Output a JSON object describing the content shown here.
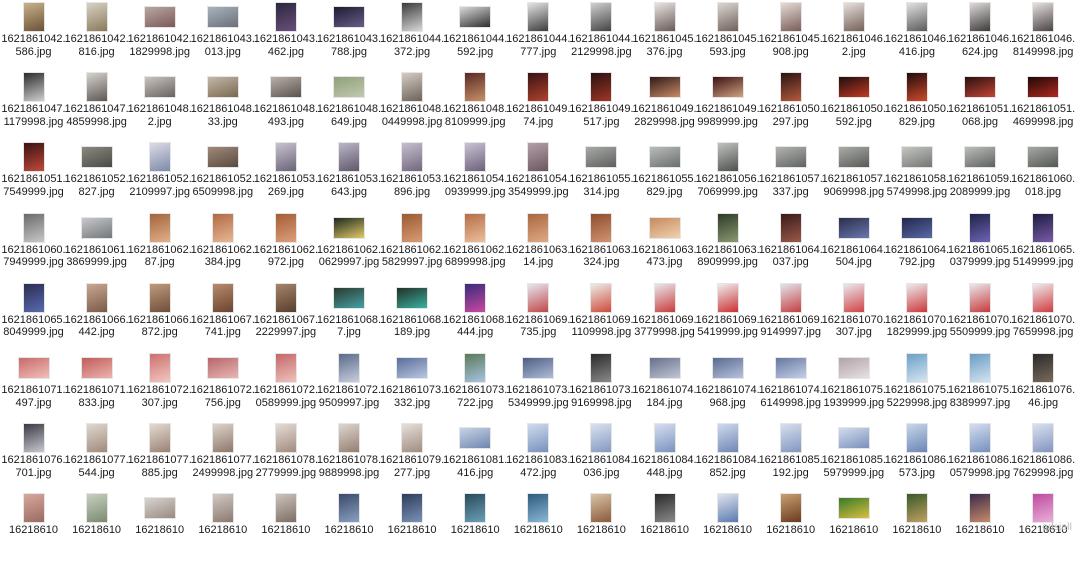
{
  "files": [
    {
      "name": "1621861042.586.jpg",
      "thumb": "p",
      "colors": [
        "#c9b28a",
        "#6b5236"
      ]
    },
    {
      "name": "1621861042.816.jpg",
      "thumb": "p",
      "colors": [
        "#d8d2c4",
        "#8a7a5a"
      ]
    },
    {
      "name": "1621861042.1829998.jpg",
      "thumb": "l",
      "colors": [
        "#b9a7a3",
        "#7b5a58"
      ]
    },
    {
      "name": "1621861043.013.jpg",
      "thumb": "l",
      "colors": [
        "#a7b3bd",
        "#6b6f78"
      ]
    },
    {
      "name": "1621861043.462.jpg",
      "thumb": "p",
      "colors": [
        "#2b2740",
        "#6a4f7a"
      ]
    },
    {
      "name": "1621861043.788.jpg",
      "thumb": "l",
      "colors": [
        "#1f1b33",
        "#6a5d88"
      ]
    },
    {
      "name": "1621861044.372.jpg",
      "thumb": "p",
      "colors": [
        "#3a3a3a",
        "#d8d8d8"
      ]
    },
    {
      "name": "1621861044.592.jpg",
      "thumb": "l",
      "colors": [
        "#d9d9d9",
        "#2e2e2e"
      ]
    },
    {
      "name": "1621861044.777.jpg",
      "thumb": "p",
      "colors": [
        "#e4e4e4",
        "#3c3c3c"
      ]
    },
    {
      "name": "1621861044.2129998.jpg",
      "thumb": "p",
      "colors": [
        "#d0d0d0",
        "#444444"
      ]
    },
    {
      "name": "1621861045.376.jpg",
      "thumb": "p",
      "colors": [
        "#e8e4e2",
        "#6a5a58"
      ]
    },
    {
      "name": "1621861045.593.jpg",
      "thumb": "p",
      "colors": [
        "#ddd6d0",
        "#6e625c"
      ]
    },
    {
      "name": "1621861045.908.jpg",
      "thumb": "p",
      "colors": [
        "#e6dcd6",
        "#7a5c58"
      ]
    },
    {
      "name": "1621861046.2.jpg",
      "thumb": "p",
      "colors": [
        "#e8e0dc",
        "#74605a"
      ]
    },
    {
      "name": "1621861046.416.jpg",
      "thumb": "p",
      "colors": [
        "#e2e2e2",
        "#5a5a5a"
      ]
    },
    {
      "name": "1621861046.624.jpg",
      "thumb": "p",
      "colors": [
        "#dedad8",
        "#3e3a3a"
      ]
    },
    {
      "name": "1621861046.8149998.jpg",
      "thumb": "p",
      "colors": [
        "#e6e2e0",
        "#4a4444"
      ]
    },
    {
      "name": "1621861047.1179998.jpg",
      "thumb": "p",
      "colors": [
        "#2c2c2c",
        "#cfcfcf"
      ]
    },
    {
      "name": "1621861047.4859998.jpg",
      "thumb": "p",
      "colors": [
        "#d6d2ce",
        "#5e5854"
      ]
    },
    {
      "name": "1621861048.2.jpg",
      "thumb": "l",
      "colors": [
        "#c8c4c0",
        "#6a625e"
      ]
    },
    {
      "name": "1621861048.33.jpg",
      "thumb": "l",
      "colors": [
        "#c4b8a8",
        "#7a6850"
      ]
    },
    {
      "name": "1621861048.493.jpg",
      "thumb": "l",
      "colors": [
        "#b8b0a8",
        "#5a524c"
      ]
    },
    {
      "name": "1621861048.649.jpg",
      "thumb": "l",
      "colors": [
        "#8fa07a",
        "#c2c8b0"
      ]
    },
    {
      "name": "1621861048.0449998.jpg",
      "thumb": "p",
      "colors": [
        "#d4ccc4",
        "#6e625a"
      ]
    },
    {
      "name": "1621861048.8109999.jpg",
      "thumb": "p",
      "colors": [
        "#5a2a22",
        "#c8906a"
      ]
    },
    {
      "name": "1621861049.74.jpg",
      "thumb": "p",
      "colors": [
        "#3a1212",
        "#b0442c"
      ]
    },
    {
      "name": "1621861049.517.jpg",
      "thumb": "p",
      "colors": [
        "#2a1010",
        "#a03626"
      ]
    },
    {
      "name": "1621861049.2829998.jpg",
      "thumb": "l",
      "colors": [
        "#2e1a18",
        "#c88a66"
      ]
    },
    {
      "name": "1621861049.9989999.jpg",
      "thumb": "l",
      "colors": [
        "#3a1212",
        "#d0a080"
      ]
    },
    {
      "name": "1621861050.297.jpg",
      "thumb": "p",
      "colors": [
        "#2a1414",
        "#b45a3a"
      ]
    },
    {
      "name": "1621861050.592.jpg",
      "thumb": "l",
      "colors": [
        "#1e0e0e",
        "#c23a22"
      ]
    },
    {
      "name": "1621861050.829.jpg",
      "thumb": "p",
      "colors": [
        "#200c0c",
        "#d04a2c"
      ]
    },
    {
      "name": "1621861051.068.jpg",
      "thumb": "l",
      "colors": [
        "#2a1010",
        "#c44434"
      ]
    },
    {
      "name": "1621861051.4699998.jpg",
      "thumb": "l",
      "colors": [
        "#200808",
        "#b02a1e"
      ]
    },
    {
      "name": "1621861051.7549999.jpg",
      "thumb": "p",
      "colors": [
        "#3a1212",
        "#c04a3a"
      ]
    },
    {
      "name": "1621861052.827.jpg",
      "thumb": "l",
      "colors": [
        "#8a8a80",
        "#4a4a44"
      ]
    },
    {
      "name": "1621861052.2109997.jpg",
      "thumb": "p",
      "colors": [
        "#dcdce6",
        "#7e8aa8"
      ]
    },
    {
      "name": "1621861052.6509998.jpg",
      "thumb": "l",
      "colors": [
        "#a08a7a",
        "#5a4a3e"
      ]
    },
    {
      "name": "1621861053.269.jpg",
      "thumb": "p",
      "colors": [
        "#c8c2d0",
        "#6a6478"
      ]
    },
    {
      "name": "1621861053.643.jpg",
      "thumb": "p",
      "colors": [
        "#bcb6c8",
        "#5e586a"
      ]
    },
    {
      "name": "1621861053.896.jpg",
      "thumb": "p",
      "colors": [
        "#c6bfd0",
        "#72687e"
      ]
    },
    {
      "name": "1621861054.0939999.jpg",
      "thumb": "p",
      "colors": [
        "#cac2d4",
        "#6c627c"
      ]
    },
    {
      "name": "1621861054.3549999.jpg",
      "thumb": "p",
      "colors": [
        "#b4a0a8",
        "#6a5660"
      ]
    },
    {
      "name": "1621861055.314.jpg",
      "thumb": "l",
      "colors": [
        "#a8aaa8",
        "#5e605c"
      ]
    },
    {
      "name": "1621861055.829.jpg",
      "thumb": "l",
      "colors": [
        "#b8bcbc",
        "#6a706e"
      ]
    },
    {
      "name": "1621861056.7069999.jpg",
      "thumb": "p",
      "colors": [
        "#c0c2c0",
        "#4e524e"
      ]
    },
    {
      "name": "1621861057.337.jpg",
      "thumb": "l",
      "colors": [
        "#b2b4b0",
        "#606460"
      ]
    },
    {
      "name": "1621861057.9069998.jpg",
      "thumb": "l",
      "colors": [
        "#aaaca8",
        "#585a56"
      ]
    },
    {
      "name": "1621861058.5749998.jpg",
      "thumb": "l",
      "colors": [
        "#c4c6c2",
        "#747672"
      ]
    },
    {
      "name": "1621861059.2089999.jpg",
      "thumb": "l",
      "colors": [
        "#bcbebc",
        "#5e625e"
      ]
    },
    {
      "name": "1621861060.018.jpg",
      "thumb": "l",
      "colors": [
        "#a6a8a4",
        "#545852"
      ]
    },
    {
      "name": "1621861060.7949999.jpg",
      "thumb": "p",
      "colors": [
        "#6a6a6a",
        "#c8c8c8"
      ]
    },
    {
      "name": "1621861061.3869999.jpg",
      "thumb": "l",
      "colors": [
        "#c8cacc",
        "#72767a"
      ]
    },
    {
      "name": "1621861062.87.jpg",
      "thumb": "p",
      "colors": [
        "#a2643e",
        "#e2b08a"
      ]
    },
    {
      "name": "1621861062.384.jpg",
      "thumb": "p",
      "colors": [
        "#b06a42",
        "#e8b894"
      ]
    },
    {
      "name": "1621861062.972.jpg",
      "thumb": "p",
      "colors": [
        "#a45c36",
        "#dca07a"
      ]
    },
    {
      "name": "1621861062.0629997.jpg",
      "thumb": "l",
      "colors": [
        "#1a2a1e",
        "#e2c86a"
      ]
    },
    {
      "name": "1621861062.5829997.jpg",
      "thumb": "p",
      "colors": [
        "#9a5a34",
        "#d89c72"
      ]
    },
    {
      "name": "1621861062.6899998.jpg",
      "thumb": "p",
      "colors": [
        "#b46e46",
        "#ecc09c"
      ]
    },
    {
      "name": "1621861063.14.jpg",
      "thumb": "p",
      "colors": [
        "#a86840",
        "#e0aa84"
      ]
    },
    {
      "name": "1621861063.324.jpg",
      "thumb": "p",
      "colors": [
        "#8e4e2e",
        "#d09470"
      ]
    },
    {
      "name": "1621861063.473.jpg",
      "thumb": "l",
      "colors": [
        "#c48a5e",
        "#f0d2b0"
      ]
    },
    {
      "name": "1621861063.8909999.jpg",
      "thumb": "p",
      "colors": [
        "#2e3a2a",
        "#8a9a6e"
      ]
    },
    {
      "name": "1621861064.037.jpg",
      "thumb": "p",
      "colors": [
        "#3a1a1a",
        "#9a5a4a"
      ]
    },
    {
      "name": "1621861064.504.jpg",
      "thumb": "l",
      "colors": [
        "#2a2e4a",
        "#6a78b0"
      ]
    },
    {
      "name": "1621861064.792.jpg",
      "thumb": "l",
      "colors": [
        "#22284a",
        "#5a6aa8"
      ]
    },
    {
      "name": "1621861065.0379999.jpg",
      "thumb": "p",
      "colors": [
        "#1e2248",
        "#6e64b4"
      ]
    },
    {
      "name": "1621861065.5149999.jpg",
      "thumb": "p",
      "colors": [
        "#1c1e3e",
        "#7a5aa8"
      ]
    },
    {
      "name": "1621861065.8049999.jpg",
      "thumb": "p",
      "colors": [
        "#2a2e52",
        "#5a6ab0"
      ]
    },
    {
      "name": "1621861066.442.jpg",
      "thumb": "p",
      "colors": [
        "#c8a890",
        "#7a5a48"
      ]
    },
    {
      "name": "1621861066.872.jpg",
      "thumb": "p",
      "colors": [
        "#c09a7c",
        "#6e4e3a"
      ]
    },
    {
      "name": "1621861067.741.jpg",
      "thumb": "p",
      "colors": [
        "#b88a6c",
        "#6a4430"
      ]
    },
    {
      "name": "1621861067.2229997.jpg",
      "thumb": "p",
      "colors": [
        "#a4846a",
        "#5a3e2e"
      ]
    },
    {
      "name": "1621861068.7.jpg",
      "thumb": "l",
      "colors": [
        "#2a3a2a",
        "#46a0a8"
      ]
    },
    {
      "name": "1621861068.189.jpg",
      "thumb": "l",
      "colors": [
        "#223028",
        "#3ab0a0"
      ]
    },
    {
      "name": "1621861068.444.jpg",
      "thumb": "p",
      "colors": [
        "#3a2a7a",
        "#c84aa0"
      ]
    },
    {
      "name": "1621861069.735.jpg",
      "thumb": "p",
      "colors": [
        "#e6e6ee",
        "#c04848"
      ]
    },
    {
      "name": "1621861069.1109998.jpg",
      "thumb": "p",
      "colors": [
        "#ecece8",
        "#d04a3a"
      ]
    },
    {
      "name": "1621861069.3779998.jpg",
      "thumb": "p",
      "colors": [
        "#e8e8ec",
        "#c83c3c"
      ]
    },
    {
      "name": "1621861069.5419999.jpg",
      "thumb": "p",
      "colors": [
        "#eeeef0",
        "#cc3030"
      ]
    },
    {
      "name": "1621861069.9149997.jpg",
      "thumb": "p",
      "colors": [
        "#e2e4ec",
        "#c44040"
      ]
    },
    {
      "name": "1621861070.307.jpg",
      "thumb": "p",
      "colors": [
        "#eae8ee",
        "#d04444"
      ]
    },
    {
      "name": "1621861070.1829999.jpg",
      "thumb": "p",
      "colors": [
        "#ecebee",
        "#cc3838"
      ]
    },
    {
      "name": "1621861070.5509999.jpg",
      "thumb": "p",
      "colors": [
        "#e8e8ec",
        "#c83a3a"
      ]
    },
    {
      "name": "1621861070.7659998.jpg",
      "thumb": "p",
      "colors": [
        "#eeecee",
        "#d03c3c"
      ]
    },
    {
      "name": "1621861071.497.jpg",
      "thumb": "l",
      "colors": [
        "#c86a6a",
        "#f0c0b8"
      ]
    },
    {
      "name": "1621861071.833.jpg",
      "thumb": "l",
      "colors": [
        "#c05c5c",
        "#ecb4ac"
      ]
    },
    {
      "name": "1621861072.307.jpg",
      "thumb": "p",
      "colors": [
        "#cc7070",
        "#f2c8c0"
      ]
    },
    {
      "name": "1621861072.756.jpg",
      "thumb": "l",
      "colors": [
        "#b8666a",
        "#e6b8b4"
      ]
    },
    {
      "name": "1621861072.0589999.jpg",
      "thumb": "p",
      "colors": [
        "#c46868",
        "#eec2bc"
      ]
    },
    {
      "name": "1621861072.9509997.jpg",
      "thumb": "p",
      "colors": [
        "#5a6a8a",
        "#c8cede"
      ]
    },
    {
      "name": "1621861073.332.jpg",
      "thumb": "l",
      "colors": [
        "#5a6e9a",
        "#b8c6e0"
      ]
    },
    {
      "name": "1621861073.722.jpg",
      "thumb": "p",
      "colors": [
        "#5a7a5a",
        "#a8c4e0"
      ]
    },
    {
      "name": "1621861073.5349999.jpg",
      "thumb": "l",
      "colors": [
        "#4e5e84",
        "#aebcd8"
      ]
    },
    {
      "name": "1621861073.9169998.jpg",
      "thumb": "p",
      "colors": [
        "#2a2a2a",
        "#8a8a8a"
      ]
    },
    {
      "name": "1621861074.184.jpg",
      "thumb": "l",
      "colors": [
        "#66708a",
        "#c0c6d6"
      ]
    },
    {
      "name": "1621861074.968.jpg",
      "thumb": "l",
      "colors": [
        "#5a6a90",
        "#b6c2dc"
      ]
    },
    {
      "name": "1621861074.6149998.jpg",
      "thumb": "l",
      "colors": [
        "#6678a0",
        "#c4d0e8"
      ]
    },
    {
      "name": "1621861075.1939999.jpg",
      "thumb": "l",
      "colors": [
        "#b0a4a8",
        "#e8e0e2"
      ]
    },
    {
      "name": "1621861075.5229998.jpg",
      "thumb": "p",
      "colors": [
        "#6aa0c8",
        "#d8e6f0"
      ]
    },
    {
      "name": "1621861075.8389997.jpg",
      "thumb": "p",
      "colors": [
        "#6a9cc4",
        "#d4e4f0"
      ]
    },
    {
      "name": "1621861076.46.jpg",
      "thumb": "p",
      "colors": [
        "#2a2a2a",
        "#7a6a5a"
      ]
    },
    {
      "name": "1621861076.701.jpg",
      "thumb": "p",
      "colors": [
        "#3a3a44",
        "#c8c8d0"
      ]
    },
    {
      "name": "1621861077.544.jpg",
      "thumb": "p",
      "colors": [
        "#e0d8d0",
        "#a08a7a"
      ]
    },
    {
      "name": "1621861077.885.jpg",
      "thumb": "p",
      "colors": [
        "#e2dad2",
        "#9a8272"
      ]
    },
    {
      "name": "1621861077.2499998.jpg",
      "thumb": "p",
      "colors": [
        "#dcd4cc",
        "#8e786a"
      ]
    },
    {
      "name": "1621861078.2779999.jpg",
      "thumb": "p",
      "colors": [
        "#e4dcd6",
        "#a28c7e"
      ]
    },
    {
      "name": "1621861078.9889998.jpg",
      "thumb": "p",
      "colors": [
        "#ddd6cf",
        "#957f70"
      ]
    },
    {
      "name": "1621861079.277.jpg",
      "thumb": "p",
      "colors": [
        "#e6e0da",
        "#a08c80"
      ]
    },
    {
      "name": "1621861081.416.jpg",
      "thumb": "l",
      "colors": [
        "#c8d4e6",
        "#6e86b0"
      ]
    },
    {
      "name": "1621861083.472.jpg",
      "thumb": "p",
      "colors": [
        "#d0dcee",
        "#7890bc"
      ]
    },
    {
      "name": "1621861084.036.jpg",
      "thumb": "p",
      "colors": [
        "#dae2f0",
        "#8498c0"
      ]
    },
    {
      "name": "1621861084.448.jpg",
      "thumb": "p",
      "colors": [
        "#d6dff0",
        "#7c92be"
      ]
    },
    {
      "name": "1621861084.852.jpg",
      "thumb": "p",
      "colors": [
        "#cfd9ec",
        "#7088b6"
      ]
    },
    {
      "name": "1621861085.192.jpg",
      "thumb": "p",
      "colors": [
        "#d8e0ee",
        "#8296c0"
      ]
    },
    {
      "name": "1621861085.5979999.jpg",
      "thumb": "l",
      "colors": [
        "#d2dcee",
        "#7a90bc"
      ]
    },
    {
      "name": "1621861086.573.jpg",
      "thumb": "p",
      "colors": [
        "#c8d6ea",
        "#6a86b6"
      ]
    },
    {
      "name": "1621861086.0579998.jpg",
      "thumb": "p",
      "colors": [
        "#d4deee",
        "#7690be"
      ]
    },
    {
      "name": "1621861086.7629998.jpg",
      "thumb": "p",
      "colors": [
        "#dae2f0",
        "#8294c0"
      ]
    },
    {
      "name": "16218610",
      "thumb": "p",
      "colors": [
        "#d8a8a0",
        "#9a6a60"
      ]
    },
    {
      "name": "16218610",
      "thumb": "p",
      "colors": [
        "#c8d0c0",
        "#7a8a70"
      ]
    },
    {
      "name": "16218610",
      "thumb": "l",
      "colors": [
        "#d8d4d0",
        "#9a8a80"
      ]
    },
    {
      "name": "16218610",
      "thumb": "p",
      "colors": [
        "#d2cac4",
        "#8a7a70"
      ]
    },
    {
      "name": "16218610",
      "thumb": "p",
      "colors": [
        "#ccc4be",
        "#7e6e64"
      ]
    },
    {
      "name": "16218610",
      "thumb": "p",
      "colors": [
        "#3a4a6a",
        "#8aa0c0"
      ]
    },
    {
      "name": "16218610",
      "thumb": "p",
      "colors": [
        "#2e3c5a",
        "#7a92b8"
      ]
    },
    {
      "name": "16218610",
      "thumb": "p",
      "colors": [
        "#2a4a5a",
        "#6aa0b8"
      ]
    },
    {
      "name": "16218610",
      "thumb": "p",
      "colors": [
        "#2e5a7a",
        "#8ab8d8"
      ]
    },
    {
      "name": "16218610",
      "thumb": "p",
      "colors": [
        "#d8c4a8",
        "#8a5a3a"
      ]
    },
    {
      "name": "16218610",
      "thumb": "p",
      "colors": [
        "#2a2a2a",
        "#8a8a8a"
      ]
    },
    {
      "name": "16218610",
      "thumb": "p",
      "colors": [
        "#e0e4ec",
        "#5a7ab0"
      ]
    },
    {
      "name": "16218610",
      "thumb": "p",
      "colors": [
        "#c8a070",
        "#6a3a20"
      ]
    },
    {
      "name": "16218610",
      "thumb": "l",
      "colors": [
        "#3a7a2a",
        "#d8c040"
      ]
    },
    {
      "name": "16218610",
      "thumb": "p",
      "colors": [
        "#3a5a2a",
        "#c0a060"
      ]
    },
    {
      "name": "16218610",
      "thumb": "p",
      "colors": [
        "#3a2a4a",
        "#c88a6a"
      ]
    },
    {
      "name": "16218610",
      "thumb": "p",
      "colors": [
        "#c04aa0",
        "#e8b0d8"
      ]
    }
  ],
  "watermark": "qdsjall"
}
